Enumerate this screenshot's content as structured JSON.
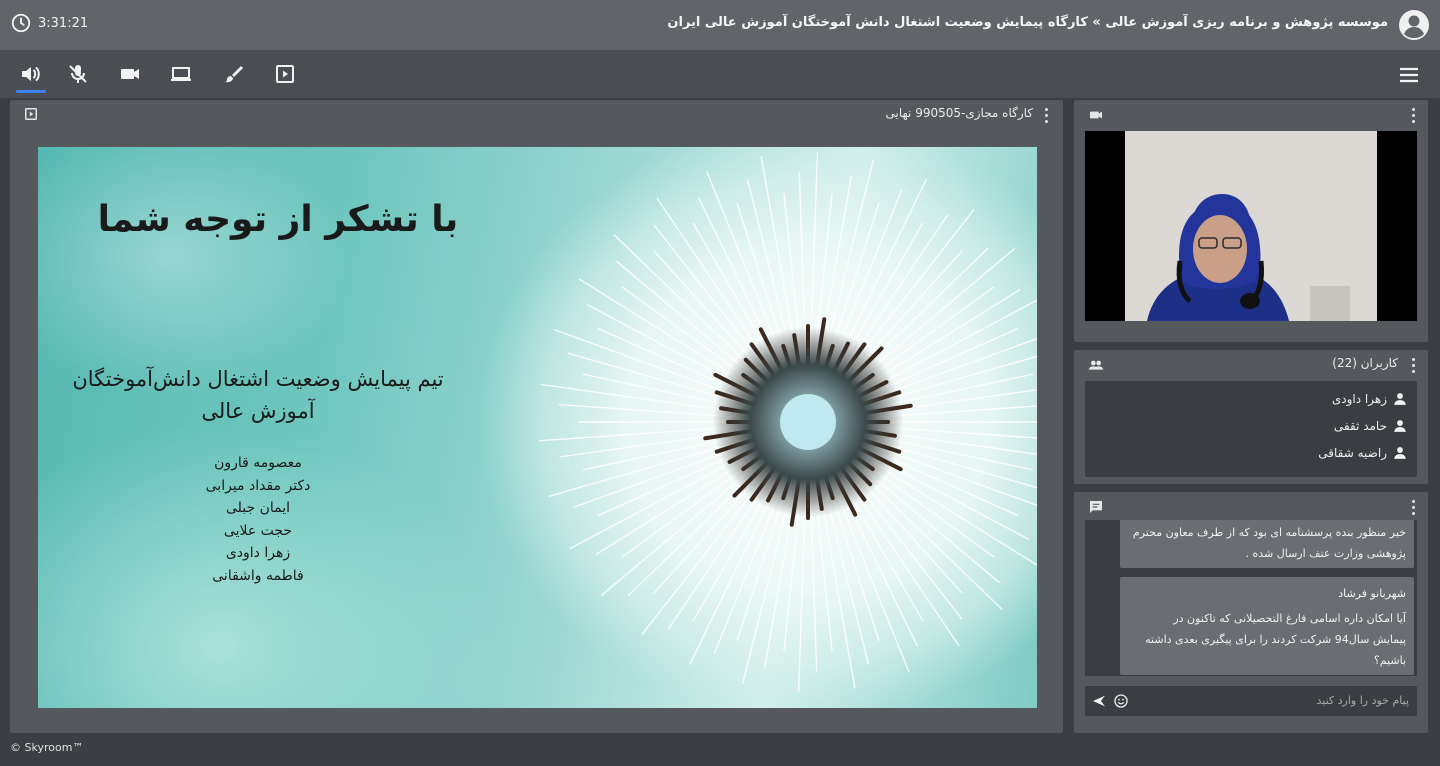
{
  "header": {
    "time": "3:31:21",
    "title": "موسسه پژوهش و برنامه ریزی آموزش عالی » کارگاه پیمایش وضعیت اشتغال دانش آموختگان آموزش عالی ایران"
  },
  "toolbar": {
    "items": [
      "speaker-icon",
      "mic-off-icon",
      "camera-icon",
      "screen-share-icon",
      "whiteboard-icon",
      "presentation-icon"
    ],
    "active": "speaker-icon"
  },
  "presentation": {
    "title": "کارگاه مجازی-990505 نهایی",
    "slide": {
      "thanks": "با تشکر از توجه شما",
      "team_line1": "تیم پیمایش وضعیت اشتغال دانش‌آموختگان",
      "team_line2": "آموزش عالی",
      "names": [
        "معصومه قارون",
        "دکتر مقداد میرابی",
        "ایمان جبلی",
        "حجت علایی",
        "زهرا داودی",
        "فاطمه واشقانی"
      ]
    }
  },
  "users": {
    "header": "کاربران (22)",
    "list": [
      "زهرا داودی",
      "حامد ثقفی",
      "راضیه شقاقی"
    ]
  },
  "chat": {
    "messages": [
      {
        "sender": "",
        "text_lines": [
          "خیر منظور بنده پرسشنامه ای بود که از طرف معاون محترم",
          "پژوهشی وزارت عتف ارسال شده ."
        ]
      },
      {
        "sender": "شهربانو فرشاد",
        "text_lines": [
          "آیا امکان داره اسامی فارغ التحصیلانی که تاکنون در",
          "پیمایش سال94 شرکت کردند را برای پیگیری بعدی داشته",
          "باشیم؟"
        ]
      }
    ],
    "input_placeholder": "پیام خود را وارد کنید"
  },
  "footer": {
    "brand": "© Skyroom™"
  },
  "colors": {
    "accent": "#3b82f6",
    "topbar": "#616468",
    "panel": "#55585c"
  }
}
